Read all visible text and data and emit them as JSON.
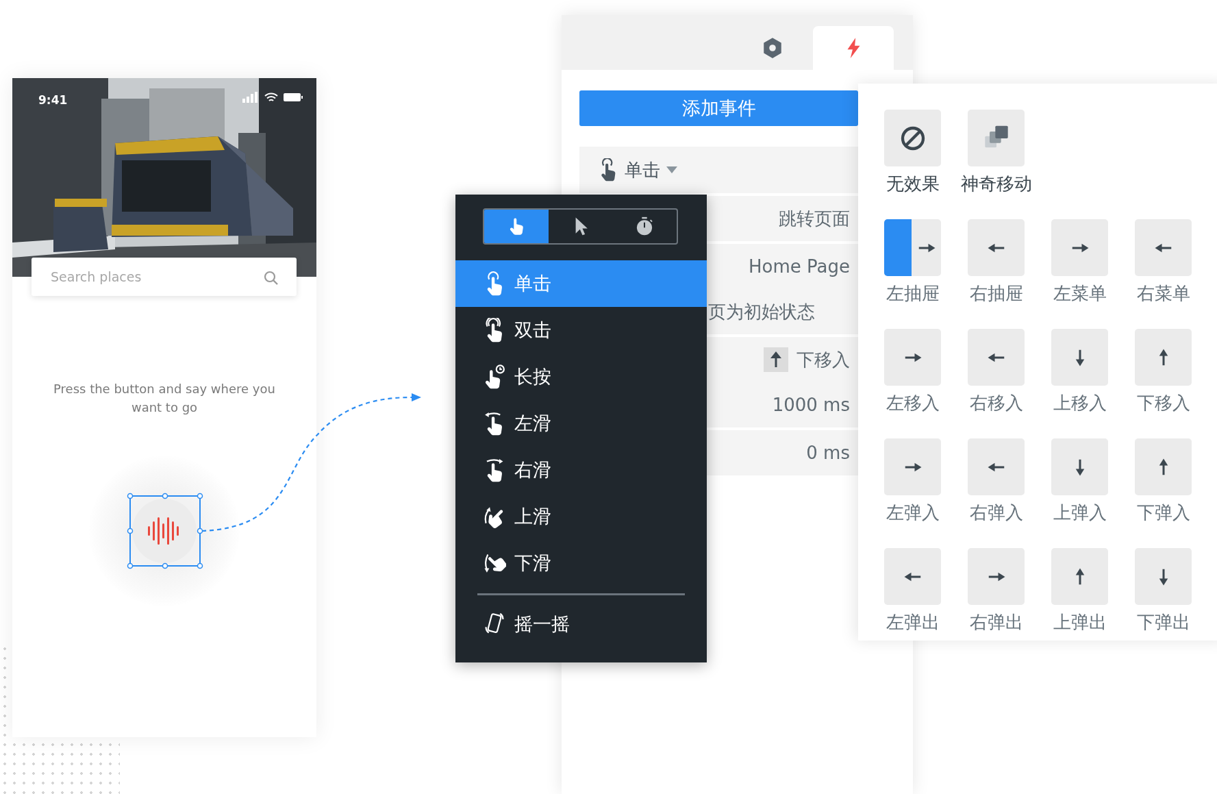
{
  "phone": {
    "time": "9:41",
    "search": {
      "placeholder": "Search places"
    },
    "hint": "Press the button and say where you want to go"
  },
  "event_panel": {
    "tabs": [
      {
        "kind": "settings",
        "selected": false
      },
      {
        "kind": "events",
        "selected": true
      }
    ],
    "add_button": "添加事件",
    "trigger": "单击",
    "action": "跳转页面",
    "target": "Home Page",
    "reset_text": "页为初始状态",
    "animation": "下移入",
    "duration": "1000 ms",
    "delay": "0 ms"
  },
  "gesture_menu": {
    "modes": [
      {
        "kind": "touch",
        "selected": true
      },
      {
        "kind": "mouse",
        "selected": false
      },
      {
        "kind": "timer",
        "selected": false
      }
    ],
    "items": [
      {
        "kind": "tap",
        "label": "单击",
        "selected": true
      },
      {
        "kind": "double",
        "label": "双击",
        "selected": false
      },
      {
        "kind": "press",
        "label": "长按",
        "selected": false
      },
      {
        "kind": "swipe-left",
        "label": "左滑",
        "selected": false
      },
      {
        "kind": "swipe-right",
        "label": "右滑",
        "selected": false
      },
      {
        "kind": "swipe-up",
        "label": "上滑",
        "selected": false
      },
      {
        "kind": "swipe-down",
        "label": "下滑",
        "selected": false
      }
    ],
    "more_items": [
      {
        "kind": "shake",
        "label": "摇一摇",
        "selected": false
      }
    ]
  },
  "effects": [
    [
      {
        "kind": "none",
        "label": "无效果",
        "selected": false
      },
      {
        "kind": "magic",
        "label": "神奇移动",
        "selected": false
      }
    ],
    [
      {
        "kind": "right",
        "label": "左抽屉",
        "selected": true
      },
      {
        "kind": "left",
        "label": "右抽屉",
        "selected": false
      },
      {
        "kind": "right",
        "label": "左菜单",
        "selected": false
      },
      {
        "kind": "left",
        "label": "右菜单",
        "selected": false
      }
    ],
    [
      {
        "kind": "right",
        "label": "左移入",
        "selected": false
      },
      {
        "kind": "left",
        "label": "右移入",
        "selected": false
      },
      {
        "kind": "down",
        "label": "上移入",
        "selected": false
      },
      {
        "kind": "up",
        "label": "下移入",
        "selected": false
      }
    ],
    [
      {
        "kind": "right",
        "label": "左弹入",
        "selected": false
      },
      {
        "kind": "left",
        "label": "右弹入",
        "selected": false
      },
      {
        "kind": "down",
        "label": "上弹入",
        "selected": false
      },
      {
        "kind": "up",
        "label": "下弹入",
        "selected": false
      }
    ],
    [
      {
        "kind": "left",
        "label": "左弹出",
        "selected": false
      },
      {
        "kind": "right",
        "label": "右弹出",
        "selected": false
      },
      {
        "kind": "up",
        "label": "上弹出",
        "selected": false
      },
      {
        "kind": "down",
        "label": "下弹出",
        "selected": false
      }
    ]
  ]
}
